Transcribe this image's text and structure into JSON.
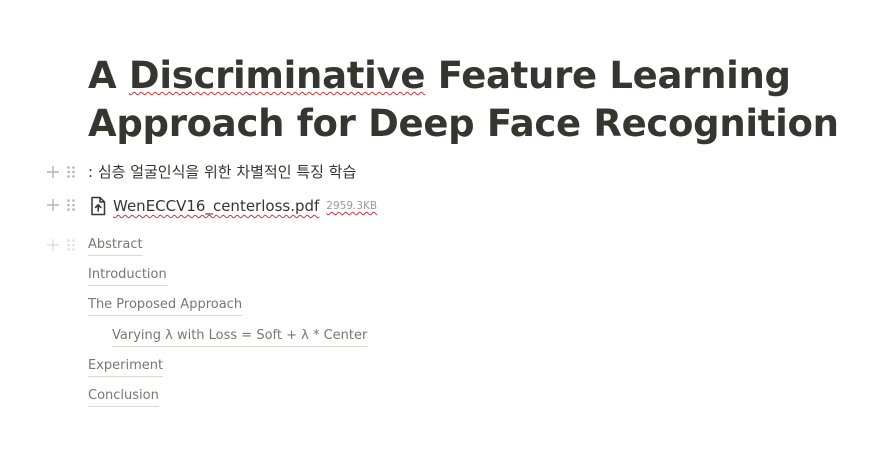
{
  "page": {
    "title_part1": "A ",
    "title_squiggle": "Discriminative",
    "title_part2": " Feature Learning Approach for Deep Face Recognition",
    "subtitle": ": 심층 얼굴인식을 위한 차별적인 특징 학습"
  },
  "attachment": {
    "icon": "file-upload-icon",
    "name": "WenECCV16_centerloss.pdf",
    "size": "2959.3KB"
  },
  "toc": [
    {
      "label": "Abstract",
      "level": 1
    },
    {
      "label": "Introduction",
      "level": 1
    },
    {
      "label": "The Proposed Approach",
      "level": 1
    },
    {
      "label": "Varying λ with Loss = Soft + λ * Center",
      "level": 2
    },
    {
      "label": "Experiment",
      "level": 1
    },
    {
      "label": "Conclusion",
      "level": 1
    }
  ],
  "colors": {
    "text": "#37352f",
    "muted": "#787774",
    "handle": "#b5b4b1",
    "spellcheck": "#d13438"
  }
}
